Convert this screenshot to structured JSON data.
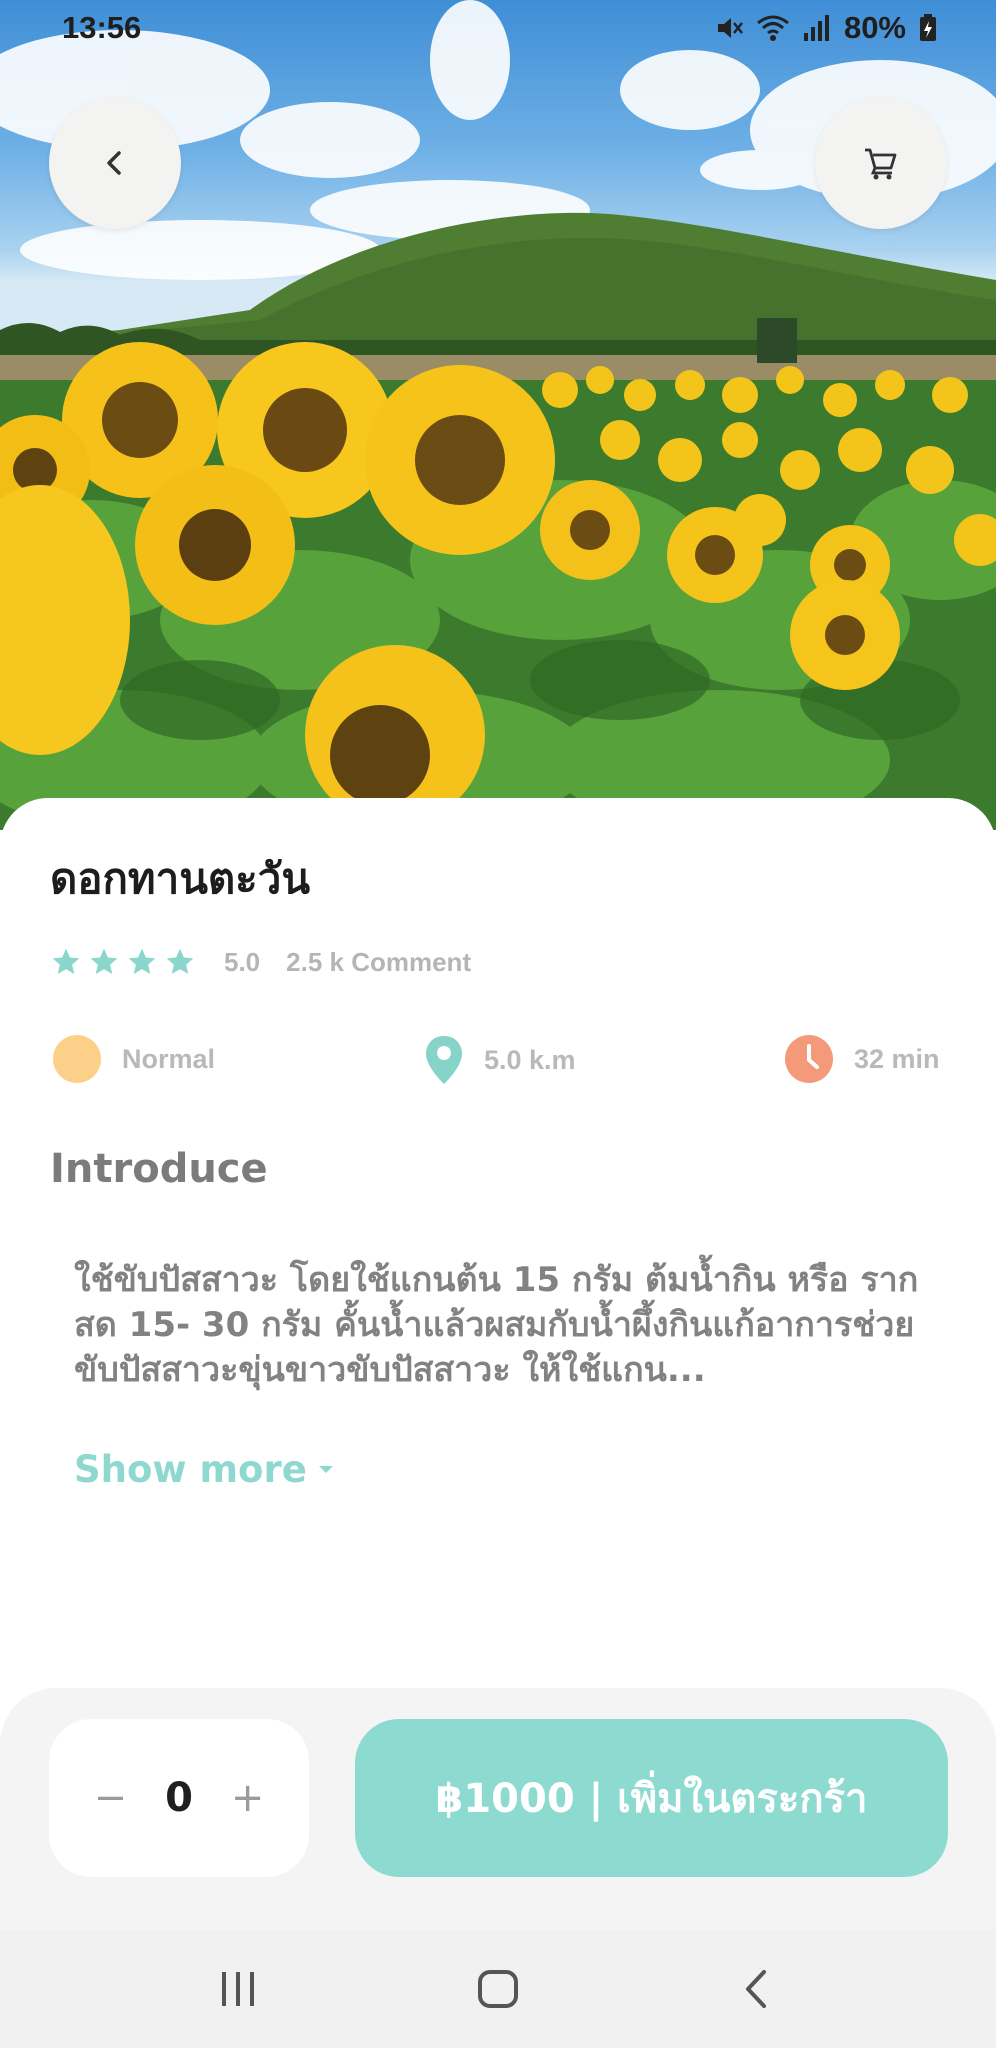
{
  "status_bar": {
    "time": "13:56",
    "battery": "80%"
  },
  "product": {
    "name": "ดอกทานตะวัน",
    "rating": "5.0",
    "comments": "2.5 k Comment",
    "stars": 4,
    "level": "Normal",
    "distance": "5.0 k.m",
    "duration": "32 min"
  },
  "intro": {
    "heading": "Introduce",
    "text": "ใช้ขับปัสสาวะ โดยใช้แกนต้น 15 กรัม ต้มน้ำกิน หรือ รากสด 15- 30 กรัม คั้นน้ำแล้วผสมกับน้ำผึ้งกินแก้อาการช่วยขับปัสสาวะขุ่นขาวขับปัสสาวะ ให้ใช้แกน...",
    "show_more": "Show more"
  },
  "cart": {
    "minus": "−",
    "quantity": "0",
    "plus": "+",
    "add_label": "฿1000 | เพิ่มในตระกร้า"
  },
  "colors": {
    "accent": "#8ddad1",
    "star": "#8ad5cc",
    "level_dot": "#fdd08a",
    "location": "#86d3c9",
    "clock": "#f49a7b"
  },
  "icons": {
    "back": "chevron-left-icon",
    "cart": "cart-icon",
    "location": "location-pin-icon",
    "clock": "clock-icon"
  }
}
